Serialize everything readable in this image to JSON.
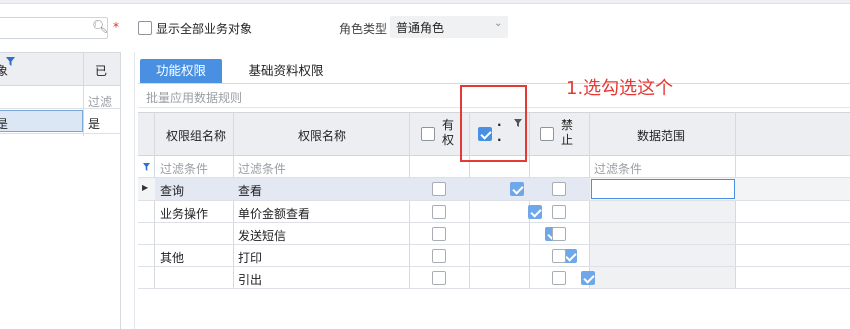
{
  "top": {
    "show_all_label": "显示全部业务对象",
    "role_type_label": "角色类型",
    "role_type_value": "普通角色",
    "required_mark": "*"
  },
  "left_panel": {
    "header_col1": "象",
    "header_col2": "已",
    "filter_col2": "过滤",
    "row_col1": "是",
    "row_col2": "是"
  },
  "tabs": [
    {
      "label": "功能权限",
      "active": true
    },
    {
      "label": "基础资料权限",
      "active": false
    }
  ],
  "batch_rule_label": "批量应用数据规则",
  "table": {
    "headers": {
      "group": "权限组名称",
      "name": "权限名称",
      "has_right": "有\n权",
      "col4": "·\n·",
      "forbid": "禁\n止",
      "scope": "数据范围"
    },
    "filter_placeholders": {
      "group": "过滤条件",
      "name": "过滤条件",
      "scope": "过滤条件"
    },
    "rows": [
      {
        "group": "查询",
        "name": "查看",
        "has_right": false,
        "checked": true,
        "forbid": false,
        "current": true
      },
      {
        "group": "业务操作",
        "name": "单价金额查看",
        "has_right": false,
        "checked": true,
        "forbid": false
      },
      {
        "group": "",
        "name": "发送短信",
        "has_right": false,
        "checked": true,
        "forbid": false
      },
      {
        "group": "其他",
        "name": "打印",
        "has_right": false,
        "checked": true,
        "forbid": false
      },
      {
        "group": "",
        "name": "引出",
        "has_right": false,
        "checked": true,
        "forbid": false
      }
    ]
  },
  "annotation": "1.选勾选这个",
  "colors": {
    "accent": "#4a90e2",
    "annotation": "#e53935"
  },
  "icons": [
    "search-icon",
    "filter-icon",
    "row-pointer-icon",
    "chevron-down-icon"
  ]
}
